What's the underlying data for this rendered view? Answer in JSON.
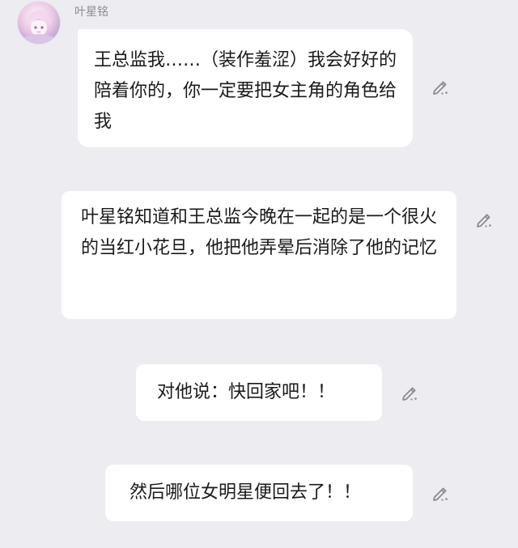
{
  "chat": {
    "sender_name": "叶星铭",
    "avatar_icon": "anime-girl-avatar",
    "messages": [
      {
        "text": "王总监我……（装作羞涩）我会好好的陪着你的，你一定要把女主角的角色给我"
      },
      {
        "text": "叶星铭知道和王总监今晚在一起的是一个很火的当红小花旦，他把他弄晕后消除了他的记忆"
      },
      {
        "text": "对他说：快回家吧！！"
      },
      {
        "text": "然后哪位女明星便回去了！！"
      }
    ],
    "edit_icon": "edit-pencil-icon"
  },
  "colors": {
    "background": "#ececf1",
    "bubble": "#ffffff",
    "text": "#1a1a1a",
    "name": "#8b8b90",
    "icon": "#8a8a8f"
  }
}
